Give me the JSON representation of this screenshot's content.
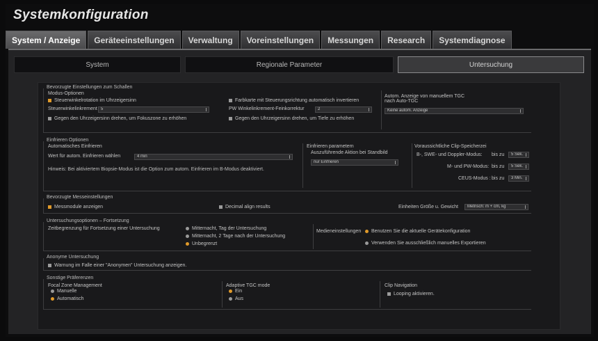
{
  "app": {
    "title": "Systemkonfiguration"
  },
  "tabs": [
    {
      "label": "System / Anzeige",
      "active": true
    },
    {
      "label": "Geräteeinstellungen"
    },
    {
      "label": "Verwaltung"
    },
    {
      "label": "Voreinstellungen"
    },
    {
      "label": "Messungen"
    },
    {
      "label": "Research"
    },
    {
      "label": "Systemdiagnose"
    }
  ],
  "subtabs": [
    {
      "label": "System"
    },
    {
      "label": "Regionale Parameter"
    },
    {
      "label": "Untersuchung",
      "active": true
    }
  ],
  "colors": {
    "accent": "#e09a2a",
    "panel": "#19191b"
  },
  "sections": {
    "schallen": {
      "title": "Bevorzugte Einstellungen zum Schallen",
      "modus_title": "Modus-Optionen",
      "steuer_rotation": {
        "label": "Steuerwinkelrotation im Uhrzeigersinn",
        "checked": true
      },
      "steuer_inkrement": {
        "label": "Steuerwinkelinkrement",
        "value": "5"
      },
      "gegen_uhrzeiger_fokus": {
        "label": "Gegen den Uhrzeigersinn drehen, um Fokuszone zu erhöhen",
        "checked": false
      },
      "farbkarte": {
        "label": "Farbkarte mit Steuerungsrichtung automatisch invertieren",
        "checked": false
      },
      "pw_winkel": {
        "label": "PW Winkelinkrement-Feinkorrektur",
        "value": "2"
      },
      "gegen_uhrzeiger_tiefe": {
        "label": "Gegen den Uhrzeigersinn drehen, um Tiefe zu erhöhen",
        "checked": false
      },
      "tgc_title_1": "Autom. Anzeige von manuellem TGC",
      "tgc_title_2": "nach Auto-TGC",
      "tgc_value": "Keine autom. Anzeige"
    },
    "einfrieren": {
      "title": "Einfrieren Optionen",
      "auto_title": "Automatisches Einfrieren",
      "wert_label": "Wert für autom. Einfrieren wählen",
      "wert_value": "4 min",
      "hinweis": "Hinweis: Bei aktiviertem Biopsie-Modus ist die Option zum autom. Einfrieren im B-Modus deaktiviert.",
      "param_title": "Einfrieren parametern",
      "aktion_label": "Auszuführende Aktion bei Standbild",
      "aktion_value": "nur Einfrieren",
      "clip_title": "Voraussichtliche Clip-Speicherzei",
      "b_swe_label": "B-, SWE- und Doppler-Modus:",
      "b_swe_value": "5 Sek.",
      "m_pw_label": "M- und PW-Modus:",
      "m_pw_value": "5 Sek.",
      "ceus_label": "CEUS-Modus :",
      "ceus_value": "3 Min.",
      "bis_zu": "bis zu"
    },
    "messen": {
      "title": "Bevorzugte Messeinstellungen",
      "messmodule": {
        "label": "Messmodule anzeigen",
        "checked": true
      },
      "decimal": {
        "label": "Decimal align results",
        "checked": false
      },
      "einheiten_label": "Einheiten Größe u. Gewicht",
      "einheiten_value": "Metrisch: m + cm, kg"
    },
    "fortsetzung": {
      "title": "Untersuchungsoptionen – Fortsetzung",
      "zeit_label": "Zeitbegrenzung für Fortsetzung einer Untersuchung",
      "opt1": {
        "label": "Mitternacht, Tag der Untersuchung",
        "checked": false
      },
      "opt2": {
        "label": "Mitternacht, 2 Tage nach der Untersuchung",
        "checked": false
      },
      "opt3": {
        "label": "Unbegrenzt",
        "checked": true
      },
      "medien_label": "Medieneinstellungen",
      "medien1": {
        "label": "Benutzen Sie die aktuelle Gerätekonfiguration",
        "checked": true
      },
      "medien2": {
        "label": "Verwenden Sie ausschließlich manuelles Exportieren",
        "checked": false
      }
    },
    "anonym": {
      "title": "Anonyme Untersuchung",
      "warnung": {
        "label": "Warnung im Falle einer \"Anonymen\" Untersuchung anzeigen.",
        "checked": false
      }
    },
    "sonstige": {
      "title": "Sonstige Präferenzen",
      "focal_title": "Focal Zone Management",
      "focal_manuell": {
        "label": "Manuelle",
        "checked": false
      },
      "focal_auto": {
        "label": "Automatisch",
        "checked": true
      },
      "tgc_title": "Adaptive TGC mode",
      "tgc_ein": {
        "label": "Ein",
        "checked": true
      },
      "tgc_aus": {
        "label": "Aus",
        "checked": false
      },
      "clip_title": "Clip Navigation",
      "looping": {
        "label": "Looping aktivieren.",
        "checked": false
      }
    }
  }
}
